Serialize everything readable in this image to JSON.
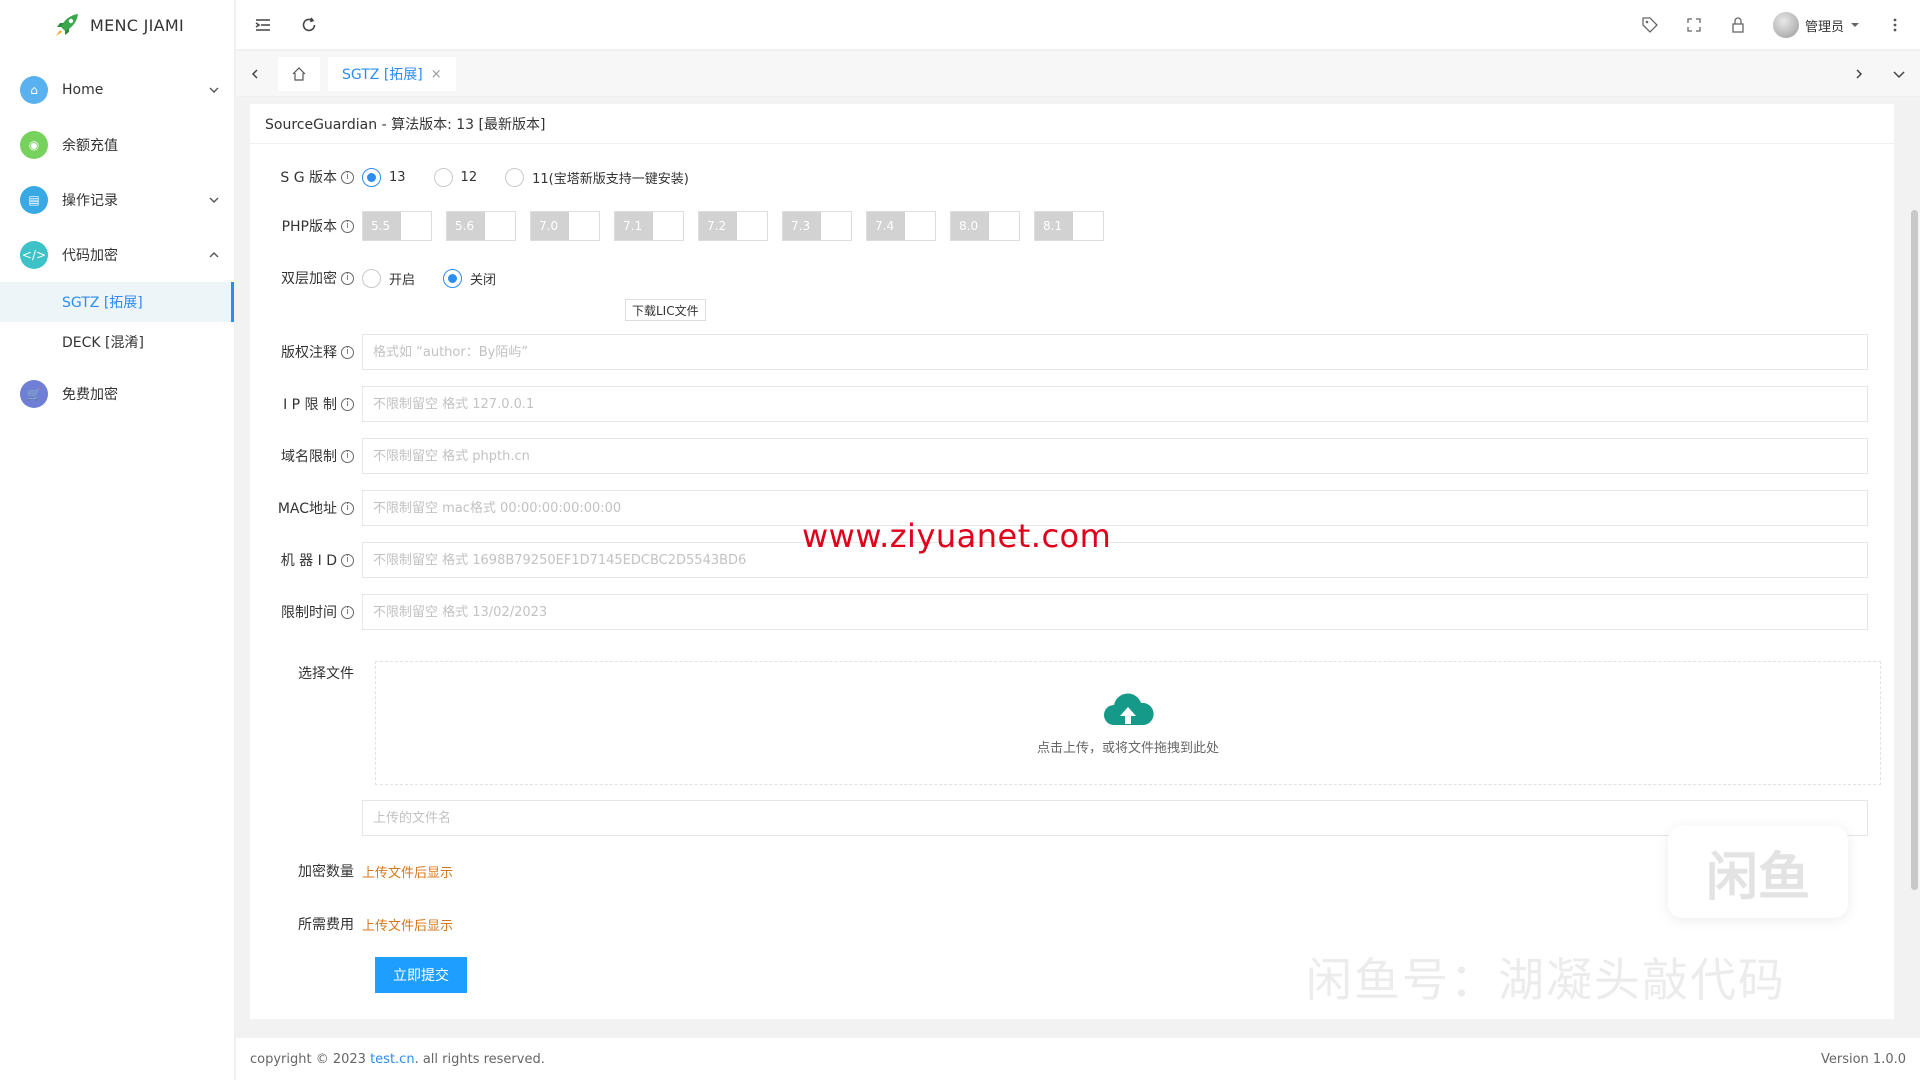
{
  "app": {
    "title": "MENC JIAMI"
  },
  "sidebar": {
    "items": [
      {
        "label": "Home",
        "color": "#5ab1ef",
        "icon": "home-icon"
      },
      {
        "label": "余额充值",
        "color": "#76d25d",
        "icon": "recharge-icon"
      },
      {
        "label": "操作记录",
        "color": "#39a9e5",
        "icon": "record-icon"
      },
      {
        "label": "代码加密",
        "color": "#3cc2c7",
        "icon": "code-icon"
      },
      {
        "label": "免费加密",
        "color": "#6f7fd6",
        "icon": "cart-icon"
      }
    ],
    "submenu": [
      {
        "label": "SGTZ [拓展]"
      },
      {
        "label": "DECK [混淆]"
      }
    ]
  },
  "header": {
    "user": "管理员"
  },
  "tabs": {
    "active": "SGTZ [拓展]",
    "close": "×"
  },
  "form": {
    "title": "SourceGuardian - 算法版本: 13 [最新版本]",
    "sg_label": "S G 版本",
    "sg_options": [
      "13",
      "12",
      "11(宝塔新版支持一键安装)"
    ],
    "php_label": "PHP版本",
    "php_versions": [
      "5.5",
      "5.6",
      "7.0",
      "7.1",
      "7.2",
      "7.3",
      "7.4",
      "8.0",
      "8.1"
    ],
    "double_label": "双层加密",
    "double_options": [
      "开启",
      "关闭"
    ],
    "download_lic": "下载LIC文件",
    "copyright_label": "版权注释",
    "copyright_ph": "格式如 “author：By陌屿”",
    "ip_label": "I P 限 制",
    "ip_ph": "不限制留空 格式 127.0.0.1",
    "domain_label": "域名限制",
    "domain_ph": "不限制留空 格式 phpth.cn",
    "mac_label": "MAC地址",
    "mac_ph": "不限制留空 mac格式 00:00:00:00:00:00",
    "machine_label": "机 器 I D",
    "machine_ph": "不限制留空 格式 1698B79250EF1D7145EDCBC2D5543BD6",
    "time_label": "限制时间",
    "time_ph": "不限制留空 格式 13/02/2023",
    "file_label": "选择文件",
    "upload_hint": "点击上传，或将文件拖拽到此处",
    "filename_ph": "上传的文件名",
    "count_label": "加密数量",
    "count_value": "上传文件后显示",
    "fee_label": "所需费用",
    "fee_value": "上传文件后显示",
    "submit": "立即提交"
  },
  "overlay": {
    "watermark": "www.ziyuanet.com",
    "badge": "闲鱼",
    "fish_text": "闲鱼号：湖凝头敲代码"
  },
  "footer": {
    "copyright_pre": "copyright © 2023 ",
    "link": "test.cn",
    "copyright_post": ". all rights reserved.",
    "version": "Version 1.0.0"
  }
}
